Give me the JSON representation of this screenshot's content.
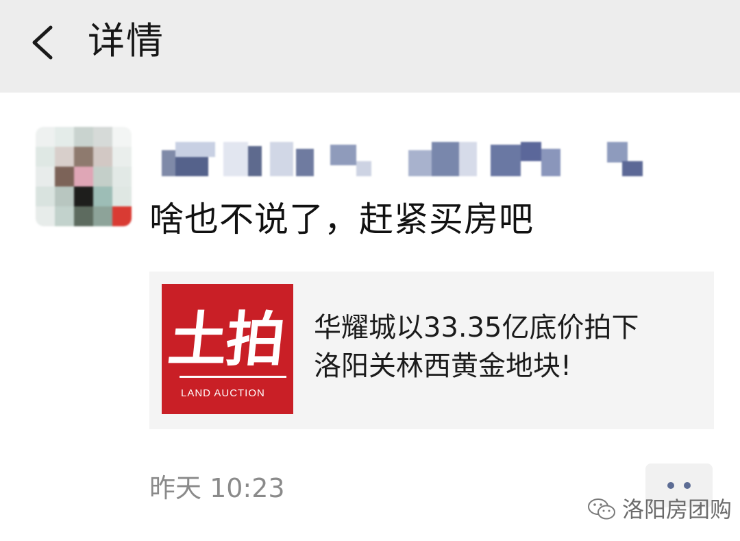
{
  "header": {
    "title": "详情",
    "back_icon": "chevron-left-icon"
  },
  "post": {
    "message": "啥也不说了，赶紧买房吧",
    "timestamp": "昨天 10:23",
    "more_icon": "more-dots-icon"
  },
  "share_card": {
    "thumbnail": {
      "title": "土拍",
      "subtitle": "LAND AUCTION"
    },
    "title_lines": [
      "华耀城以33.35亿底价拍下",
      "洛阳关林西黄金地块!"
    ]
  },
  "watermark": {
    "text": "洛阳房团购",
    "icon": "wechat-icon"
  },
  "colors": {
    "header_bg": "#ededed",
    "card_bg": "#f4f4f4",
    "thumbnail_red": "#c91f26",
    "time_gray": "#8a8a8a",
    "dots_blue": "#5c6c94"
  }
}
